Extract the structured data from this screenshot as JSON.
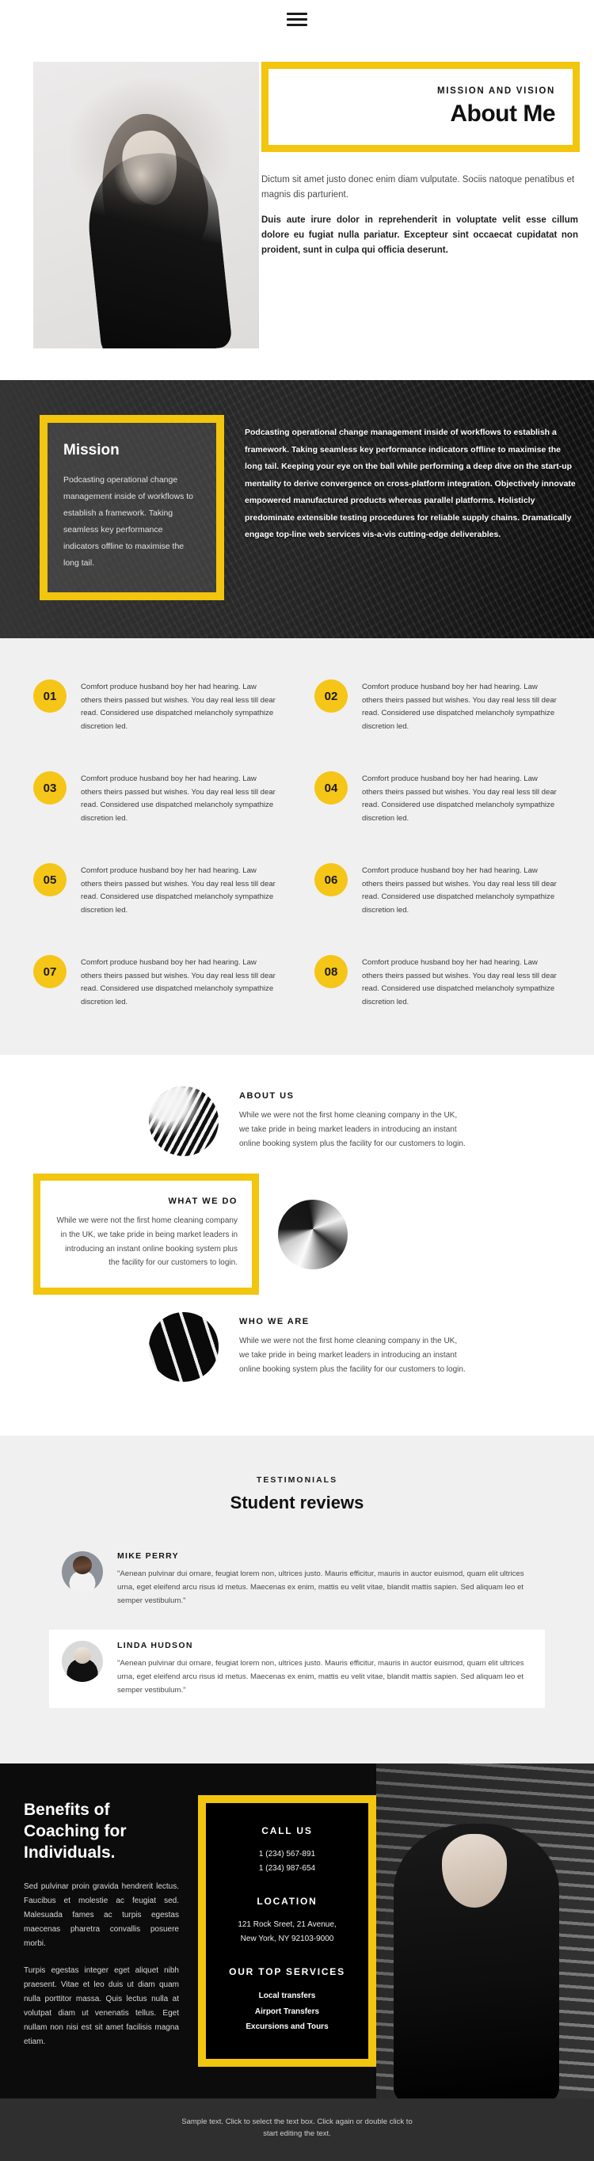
{
  "header": {
    "menu_icon": "hamburger-menu-icon"
  },
  "hero": {
    "eyebrow": "MISSION AND VISION",
    "title": "About Me",
    "paragraph_light": "Dictum sit amet justo donec enim diam vulputate. Sociis natoque penatibus et magnis dis parturient.",
    "paragraph_bold": "Duis aute irure dolor in reprehenderit in voluptate velit esse cillum dolore eu fugiat nulla pariatur. Excepteur sint occaecat cupidatat non proident, sunt in culpa qui officia deserunt."
  },
  "mission": {
    "card_title": "Mission",
    "card_text": "Podcasting operational change management inside of workflows to establish a framework. Taking seamless key performance indicators offline to maximise the long tail.",
    "body_text": "Podcasting operational change management inside of workflows to establish a framework. Taking seamless key performance indicators offline to maximise the long tail. Keeping your eye on the ball while performing a deep dive on the start-up mentality to derive convergence on cross-platform integration. Objectively innovate empowered manufactured products whereas parallel platforms. Holisticly predominate extensible testing procedures for reliable supply chains. Dramatically engage top-line web services vis-a-vis cutting-edge deliverables."
  },
  "features": [
    {
      "num": "01",
      "text": "Comfort produce husband boy her had hearing. Law others theirs passed but wishes. You day real less till dear read. Considered use dispatched melancholy sympathize discretion led."
    },
    {
      "num": "02",
      "text": "Comfort produce husband boy her had hearing. Law others theirs passed but wishes. You day real less till dear read. Considered use dispatched melancholy sympathize discretion led."
    },
    {
      "num": "03",
      "text": "Comfort produce husband boy her had hearing. Law others theirs passed but wishes. You day real less till dear read. Considered use dispatched melancholy sympathize discretion led."
    },
    {
      "num": "04",
      "text": "Comfort produce husband boy her had hearing. Law others theirs passed but wishes. You day real less till dear read. Considered use dispatched melancholy sympathize discretion led."
    },
    {
      "num": "05",
      "text": "Comfort produce husband boy her had hearing. Law others theirs passed but wishes. You day real less till dear read. Considered use dispatched melancholy sympathize discretion led."
    },
    {
      "num": "06",
      "text": "Comfort produce husband boy her had hearing. Law others theirs passed but wishes. You day real less till dear read. Considered use dispatched melancholy sympathize discretion led."
    },
    {
      "num": "07",
      "text": "Comfort produce husband boy her had hearing. Law others theirs passed but wishes. You day real less till dear read. Considered use dispatched melancholy sympathize discretion led."
    },
    {
      "num": "08",
      "text": "Comfort produce husband boy her had hearing. Law others theirs passed but wishes. You day real less till dear read. Considered use dispatched melancholy sympathize discretion led."
    }
  ],
  "blocks": [
    {
      "title": "ABOUT US",
      "text": "While we were not the first home cleaning company in the UK, we take pride in being market leaders in introducing an instant online booking system plus the facility for our customers to login.",
      "image": "gears-photo"
    },
    {
      "title": "WHAT WE DO",
      "text": "While we were not the first home cleaning company in the UK, we take pride in being market leaders in introducing an instant online booking system plus the facility for our customers to login.",
      "image": "road-photo"
    },
    {
      "title": "WHO WE ARE",
      "text": "While we were not the first home cleaning company in the UK, we take pride in being market leaders in introducing an instant online booking system plus the facility for our customers to login.",
      "image": "architecture-photo"
    }
  ],
  "testimonials": {
    "eyebrow": "TESTIMONIALS",
    "title": "Student reviews",
    "reviews": [
      {
        "name": "MIKE PERRY",
        "quote": "\"Aenean pulvinar dui ornare, feugiat lorem non, ultrices justo. Mauris efficitur, mauris in auctor euismod, quam elit ultrices urna, eget eleifend arcu risus id metus. Maecenas ex enim, mattis eu velit vitae, blandit mattis sapien. Sed aliquam leo et semper vestibulum.\""
      },
      {
        "name": "LINDA HUDSON",
        "quote": "\"Aenean pulvinar dui ornare, feugiat lorem non, ultrices justo. Mauris efficitur, mauris in auctor euismod, quam elit ultrices urna, eget eleifend arcu risus id metus. Maecenas ex enim, mattis eu velit vitae, blandit mattis sapien. Sed aliquam leo et semper vestibulum.\""
      }
    ]
  },
  "footer": {
    "title": "Benefits of Coaching for Individuals.",
    "paragraph1": "Sed pulvinar proin gravida hendrerit lectus. Faucibus et molestie ac feugiat sed. Malesuada fames ac turpis egestas maecenas pharetra convallis posuere morbi.",
    "paragraph2": "Turpis egestas integer eget aliquet nibh praesent. Vitae et leo duis ut diam quam nulla porttitor massa. Quis lectus nulla at volutpat diam ut venenatis tellus. Eget nullam non nisi est sit amet facilisis magna etiam.",
    "call_us_heading": "CALL US",
    "phone1": "1 (234) 567-891",
    "phone2": "1 (234) 987-654",
    "location_heading": "LOCATION",
    "address1": "121 Rock Sreet, 21 Avenue,",
    "address2": "New York, NY 92103-9000",
    "services_heading": "OUR TOP SERVICES",
    "services": [
      "Local transfers",
      "Airport Transfers",
      "Excursions and Tours"
    ],
    "note": "Sample text. Click to select the text box. Click again or double click to start editing the text."
  },
  "colors": {
    "accent": "#f2c50e",
    "accent_circle": "#f5c518",
    "dark": "#0c0c0c",
    "light_grey": "#f0f0f0"
  }
}
